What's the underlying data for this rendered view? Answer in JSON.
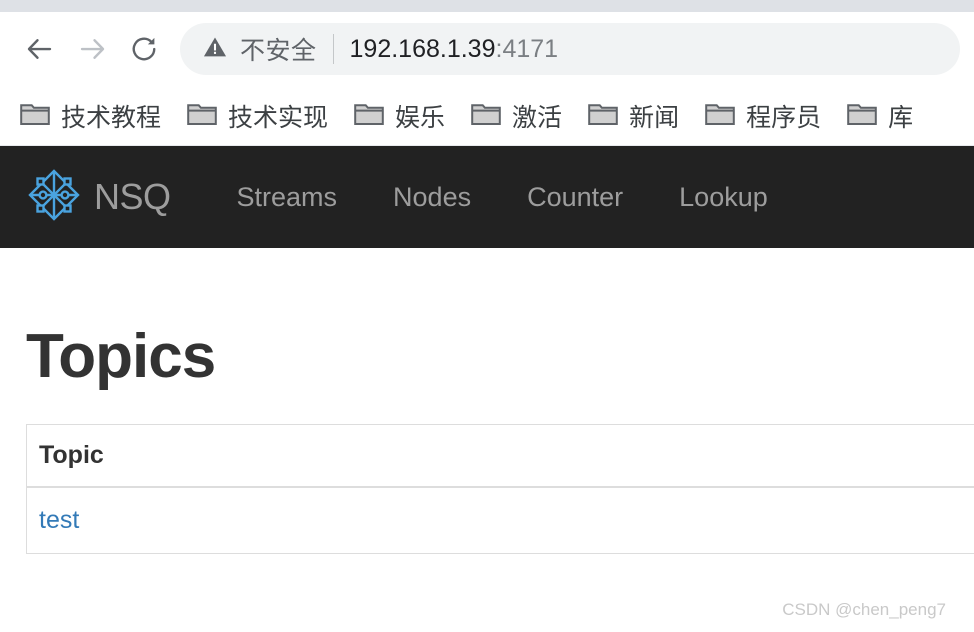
{
  "browser": {
    "nav": {
      "back_icon": "arrow-left-icon",
      "forward_icon": "arrow-right-icon",
      "reload_icon": "reload-icon"
    },
    "omnibox": {
      "security_icon": "warning-triangle-icon",
      "security_label": "不安全",
      "url_host": "192.168.1.39",
      "url_port": ":4171"
    },
    "bookmarks": {
      "folder_icon": "folder-icon",
      "items": [
        {
          "label": "技术教程"
        },
        {
          "label": "技术实现"
        },
        {
          "label": "娱乐"
        },
        {
          "label": "激活"
        },
        {
          "label": "新闻"
        },
        {
          "label": "程序员"
        },
        {
          "label": "库"
        }
      ]
    }
  },
  "navbar": {
    "logo_icon": "nsq-diamond-logo-icon",
    "brand": "NSQ",
    "links": [
      {
        "label": "Streams"
      },
      {
        "label": "Nodes"
      },
      {
        "label": "Counter"
      },
      {
        "label": "Lookup"
      }
    ]
  },
  "main": {
    "title": "Topics",
    "table": {
      "columns": [
        "Topic"
      ],
      "rows": [
        {
          "topic": "test"
        }
      ]
    }
  },
  "watermark": "CSDN @chen_peng7",
  "colors": {
    "navbar_bg": "#222222",
    "navbar_text": "#9d9d9d",
    "logo_blue": "#4aa3df",
    "link_blue": "#337ab7",
    "title_gray": "#333333",
    "omnibox_bg": "#f1f3f4",
    "tabstrip_gray": "#dee1e6",
    "table_border": "#dddddd",
    "watermark_gray": "#c9c9c9"
  }
}
